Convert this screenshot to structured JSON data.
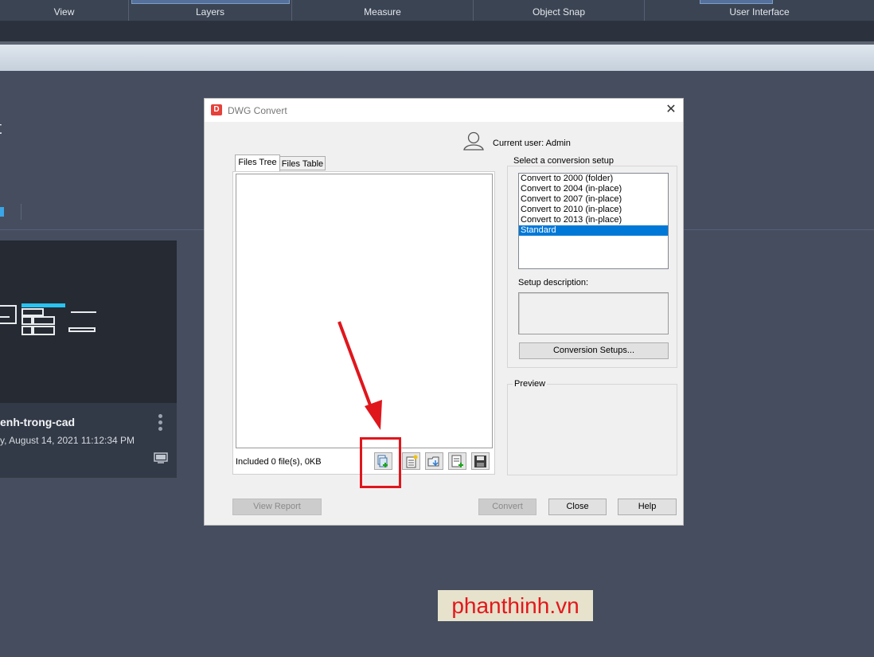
{
  "ribbon": {
    "tabs": [
      "View",
      "Layers",
      "Measure",
      "Object Snap",
      "User Interface"
    ]
  },
  "background": {
    "heading": "t",
    "card": {
      "title": "enh-trong-cad",
      "date": "y, August 14, 2021 11:12:34 PM"
    }
  },
  "dialog": {
    "title": "DWG Convert",
    "current_user": "Current user: Admin",
    "tabs": {
      "files_tree": "Files Tree",
      "files_table": "Files Table"
    },
    "files_status": "Included 0 file(s), 0KB",
    "conversion_group": {
      "label": "Select a conversion setup",
      "items": [
        "Convert to 2000 (folder)",
        "Convert to 2004 (in-place)",
        "Convert to 2007 (in-place)",
        "Convert to 2010 (in-place)",
        "Convert to 2013 (in-place)",
        "Standard"
      ],
      "selected": "Standard",
      "description_label": "Setup description:",
      "setups_button": "Conversion Setups..."
    },
    "preview_label": "Preview",
    "buttons": {
      "view_report": "View Report",
      "convert": "Convert",
      "close": "Close",
      "help": "Help"
    }
  },
  "watermark": "phanthinh.vn",
  "colors": {
    "accent_selection": "#0078d7",
    "annotation_red": "#e0161d",
    "app_background": "#454d5f"
  }
}
